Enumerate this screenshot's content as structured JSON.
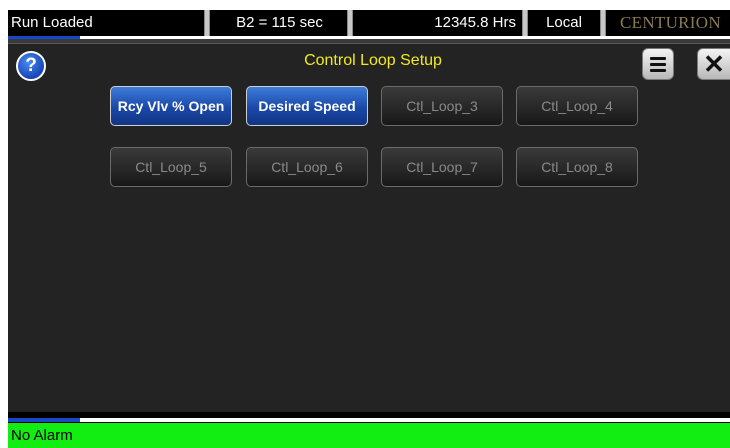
{
  "status_bar": {
    "mode": "Run Loaded",
    "timer": "B2 = 115 sec",
    "hours": "12345.8 Hrs",
    "location": "Local",
    "brand": "CENTURION"
  },
  "header": {
    "help_icon_glyph": "?",
    "title": "Control Loop Setup",
    "menu_icon": "hamburger-menu-icon",
    "close_icon_glyph": "✕"
  },
  "loops": [
    {
      "label": "Rcy Vlv % Open",
      "state": "active"
    },
    {
      "label": "Desired Speed",
      "state": "active"
    },
    {
      "label": "Ctl_Loop_3",
      "state": "inactive"
    },
    {
      "label": "Ctl_Loop_4",
      "state": "inactive"
    },
    {
      "label": "Ctl_Loop_5",
      "state": "inactive"
    },
    {
      "label": "Ctl_Loop_6",
      "state": "inactive"
    },
    {
      "label": "Ctl_Loop_7",
      "state": "inactive"
    },
    {
      "label": "Ctl_Loop_8",
      "state": "inactive"
    }
  ],
  "alarm": {
    "text": "No Alarm"
  },
  "progress": {
    "top_fraction": 0.1,
    "bottom_fraction": 0.1
  },
  "colors": {
    "title": "#f2ea1e",
    "active_button": "#1a48a8",
    "alarm_ok": "#12ee12",
    "brand": "#8a7b55"
  }
}
